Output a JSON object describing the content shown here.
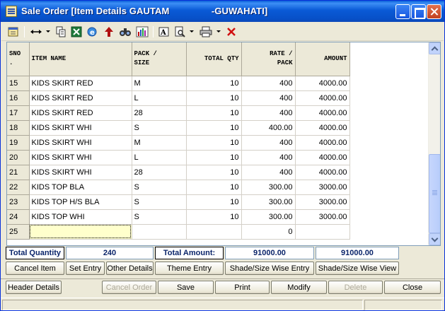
{
  "window": {
    "title": "Sale Order [Item Details GAUTAM                -GUWAHATI]",
    "accent": "#0a5ad6",
    "close_color": "#c3411f"
  },
  "toolbar": {
    "icons": [
      "form-icon",
      "resize-columns-icon",
      "copy-icon",
      "excel-icon",
      "browser-icon",
      "arrow-up-icon",
      "find-icon",
      "chart-icon",
      "text-icon",
      "print-preview-icon",
      "printer-icon",
      "delete-x-icon"
    ]
  },
  "grid": {
    "columns": [
      {
        "label": "SNO\n.",
        "align": "left"
      },
      {
        "label": "ITEM NAME",
        "align": "left"
      },
      {
        "label": "PACK /\nSIZE",
        "align": "left"
      },
      {
        "label": "TOTAL QTY",
        "align": "right"
      },
      {
        "label": "RATE /\nPACK",
        "align": "right"
      },
      {
        "label": "AMOUNT",
        "align": "right"
      }
    ],
    "rows": [
      [
        "15",
        "KIDS SKIRT RED",
        "M",
        "10",
        "400",
        "4000.00"
      ],
      [
        "16",
        "KIDS SKIRT RED",
        "L",
        "10",
        "400",
        "4000.00"
      ],
      [
        "17",
        "KIDS SKIRT RED",
        "28",
        "10",
        "400",
        "4000.00"
      ],
      [
        "18",
        "KIDS SKIRT WHI",
        "S",
        "10",
        "400.00",
        "4000.00"
      ],
      [
        "19",
        "KIDS SKIRT WHI",
        "M",
        "10",
        "400",
        "4000.00"
      ],
      [
        "20",
        "KIDS SKIRT WHI",
        "L",
        "10",
        "400",
        "4000.00"
      ],
      [
        "21",
        "KIDS SKIRT WHI",
        "28",
        "10",
        "400",
        "4000.00"
      ],
      [
        "22",
        "KIDS TOP BLA",
        "S",
        "10",
        "300.00",
        "3000.00"
      ],
      [
        "23",
        "KIDS TOP H/S BLA",
        "S",
        "10",
        "300.00",
        "3000.00"
      ],
      [
        "24",
        "KIDS TOP WHI",
        "S",
        "10",
        "300.00",
        "3000.00"
      ],
      [
        "25",
        "",
        "",
        "",
        "0",
        ""
      ]
    ],
    "active_cell_color": "#ffffcc"
  },
  "totals": {
    "qty_label": "Total Quantity",
    "qty_value": "240",
    "amount_label": "Total Amount:",
    "amount_value": "91000.00",
    "amount_value2": "91000.00",
    "label_color": "#0a246a"
  },
  "actions": {
    "cancel_item": "Cancel Item",
    "set_entry": "Set Entry",
    "other_details": "Other Details",
    "theme_entry": "Theme Entry",
    "shade_size_entry": "Shade/Size Wise Entry",
    "shade_size_view": "Shade/Size Wise View"
  },
  "bottom": {
    "header_details": "Header Details",
    "cancel_order": "Cancel Order",
    "save": "Save",
    "print": "Print",
    "modify": "Modify",
    "delete": "Delete",
    "close": "Close"
  }
}
